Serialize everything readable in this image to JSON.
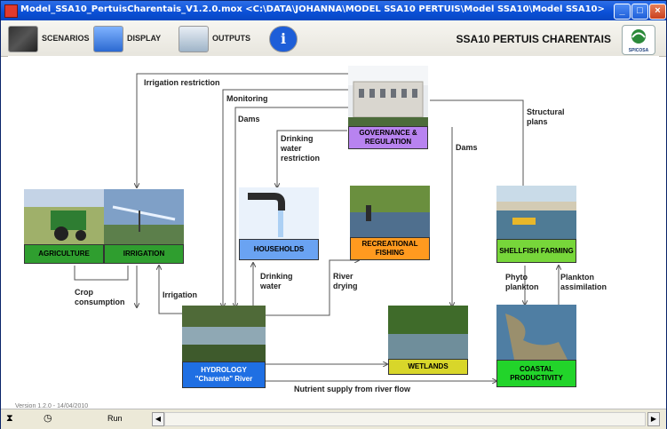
{
  "window": {
    "title": "Model_SSA10_PertuisCharentais_V1.2.0.mox   <C:\\DATA\\JOHANNA\\MODEL SSA10 PERTUIS\\Model SSA10\\Model SSA10>"
  },
  "toolbar": {
    "scenarios_label": "SCENARIOS",
    "display_label": "DISPLAY",
    "outputs_label": "OUTPUTS",
    "info_label": "i",
    "model_title": "SSA10 PERTUIS CHARENTAIS",
    "logo_text": "SPICOSA"
  },
  "nodes": {
    "governance": "GOVERNANCE & REGULATION",
    "agriculture": "AGRICULTURE",
    "irrigation": "IRRIGATION",
    "households": "HOUSEHOLDS",
    "recreational": "RECREATIONAL FISHING",
    "shellfish": "SHELLFISH FARMING",
    "hydrology": "HYDROLOGY \"Charente\" River",
    "wetlands": "WETLANDS",
    "coastal": "COASTAL PRODUCTIVITY"
  },
  "edges": {
    "irrigation_restriction": "Irrigation restriction",
    "monitoring": "Monitoring",
    "dams1": "Dams",
    "dams2": "Dams",
    "drinking_restriction": "Drinking water restriction",
    "structural_plans": "Structural plans",
    "crop_consumption": "Crop consumption",
    "irrigation": "Irrigation",
    "drinking_water": "Drinking water",
    "river_drying": "River drying",
    "phyto_plankton": "Phyto plankton",
    "plankton_assimilation": "Plankton assimilation",
    "nutrient_supply": "Nutrient supply from river flow"
  },
  "status": {
    "version": "Version 1.2.0 - 14/04/2010",
    "run_label": "Run"
  },
  "colors": {
    "governance": "#b883f0",
    "agriculture": "#2f9e2f",
    "households": "#6aa3f2",
    "recreational": "#ff9a1f",
    "shellfish": "#77d63a",
    "hydrology": "#1f6fe3",
    "wetlands": "#d8d62a",
    "coastal": "#22d42a"
  }
}
